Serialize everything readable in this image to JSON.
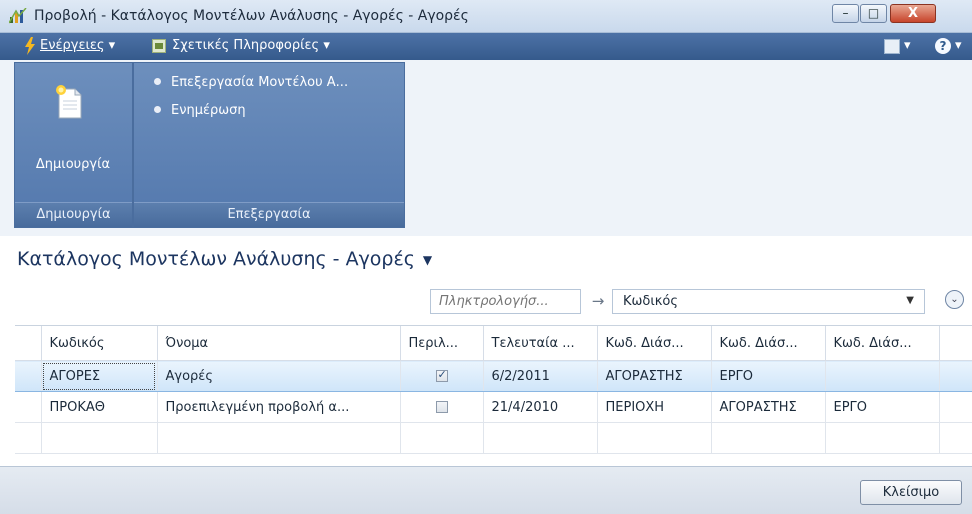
{
  "window": {
    "title": "Προβολή - Κατάλογος Μοντέλων Ανάλυσης - Αγορές - Αγορές",
    "minimize_glyph": "–",
    "maximize_glyph": "□",
    "close_glyph": "X"
  },
  "command_bar": {
    "actions_label": "Ενέργειες",
    "related_info_label": "Σχετικές Πληροφορίες",
    "help_glyph": "?"
  },
  "ribbon": {
    "groups": [
      {
        "name": "Δημιουργία",
        "button_label": "Δημιουργία"
      },
      {
        "name": "Επεξεργασία",
        "items": [
          "Επεξεργασία Μοντέλου Α...",
          "Ενημέρωση"
        ]
      }
    ]
  },
  "page": {
    "title": "Κατάλογος Μοντέλων Ανάλυσης - Αγορές"
  },
  "filter": {
    "search_placeholder": "Πληκτρολογήσ...",
    "field_value": "Κωδικός"
  },
  "table": {
    "columns": [
      "Κωδικός",
      "Όνομα",
      "Περιλ...",
      "Τελευταία ...",
      "Κωδ. Διάσ...",
      "Κωδ. Διάσ...",
      "Κωδ. Διάσ..."
    ],
    "rows": [
      {
        "code": "ΑΓΟΡΕΣ",
        "name": "Αγορές",
        "included": true,
        "last_date": "6/2/2011",
        "dim1": "ΑΓΟΡΑΣΤΗΣ",
        "dim2": "ΕΡΓΟ",
        "dim3": "",
        "selected": true
      },
      {
        "code": "ΠΡΟΚΑΘ",
        "name": "Προεπιλεγμένη προβολή α...",
        "included": false,
        "last_date": "21/4/2010",
        "dim1": "ΠΕΡΙΟΧΗ",
        "dim2": "ΑΓΟΡΑΣΤΗΣ",
        "dim3": "ΕΡΓΟ",
        "selected": false
      }
    ]
  },
  "footer": {
    "close_label": "Κλείσιμο"
  },
  "colors": {
    "command_bar": "#355a8c",
    "ribbon_group": "#5378ad",
    "selected_row": "#cfe5f9",
    "title_text": "#1c3560"
  }
}
